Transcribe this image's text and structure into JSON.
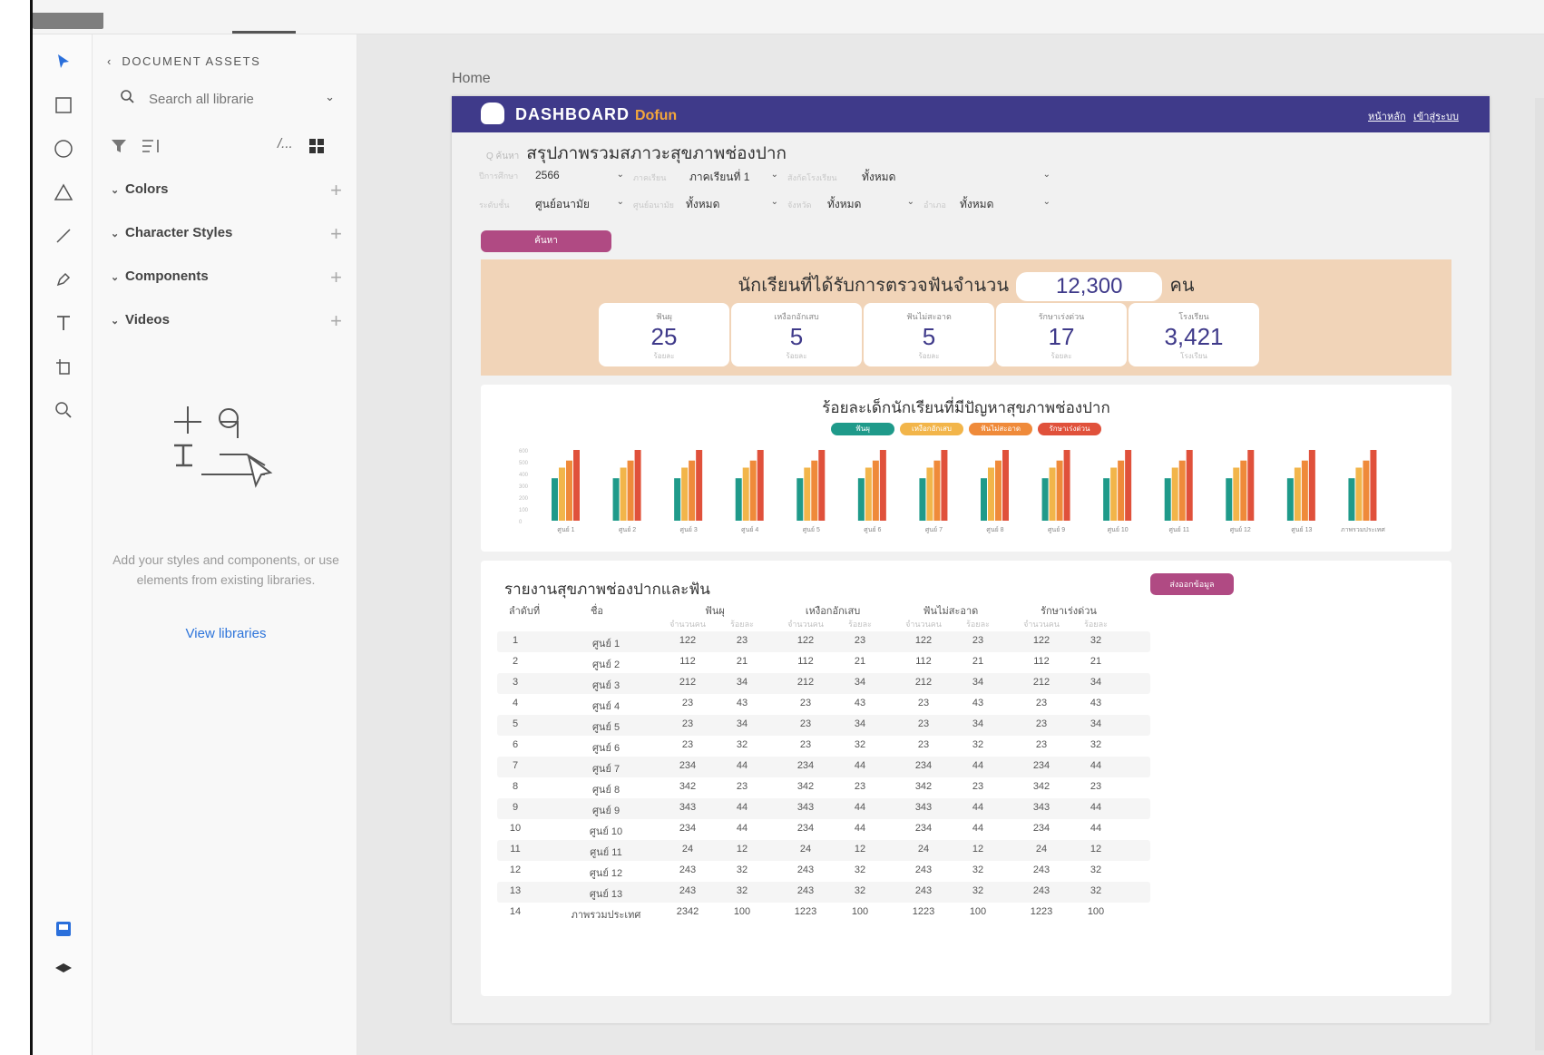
{
  "assets_panel": {
    "header": "DOCUMENT ASSETS",
    "search_placeholder": "Search all librarie",
    "tools_more": "/...",
    "sections": [
      {
        "label": "Colors"
      },
      {
        "label": "Character Styles"
      },
      {
        "label": "Components"
      },
      {
        "label": "Videos"
      }
    ],
    "empty_text": "Add your styles and components, or use elements from existing libraries.",
    "view_libraries": "View libraries"
  },
  "canvas": {
    "breadcrumb": "Home"
  },
  "dashboard": {
    "brand": "DASHBOARD",
    "brand_sub": "Dofun",
    "nav_links": [
      "หน้าหลัก",
      "เข้าสู่ระบบ"
    ],
    "page_title": "สรุปภาพรวมสภาวะสุขภาพช่องปาก",
    "page_title_prefix": "Q ค้นหา",
    "filters": [
      {
        "label": "ปีการศึกษา",
        "value": "2566"
      },
      {
        "label": "ภาคเรียน",
        "value": "ภาคเรียนที่ 1"
      },
      {
        "label": "สังกัดโรงเรียน",
        "value": "ทั้งหมด"
      },
      {
        "label": "ระดับชั้น",
        "value": "ศูนย์อนามัย"
      },
      {
        "label": "ศูนย์อนามัย",
        "value": "ทั้งหมด"
      },
      {
        "label": "จังหวัด",
        "value": "ทั้งหมด"
      },
      {
        "label": "อำเภอ",
        "value": "ทั้งหมด"
      }
    ],
    "search_button": "ค้นหา",
    "summary": {
      "headline": "นักเรียนที่ได้รับการตรวจฟันจำนวน",
      "total": "12,300",
      "unit": "คน",
      "stats": [
        {
          "label": "ฟันผุ",
          "value": "25",
          "unit": "ร้อยละ"
        },
        {
          "label": "เหงือกอักเสบ",
          "value": "5",
          "unit": "ร้อยละ"
        },
        {
          "label": "ฟันไม่สะอาด",
          "value": "5",
          "unit": "ร้อยละ"
        },
        {
          "label": "รักษาเร่งด่วน",
          "value": "17",
          "unit": "ร้อยละ"
        },
        {
          "label": "โรงเรียน",
          "value": "3,421",
          "unit": "โรงเรียน"
        }
      ]
    },
    "chart_title": "ร้อยละเด็กนักเรียนที่มีปัญหาสุขภาพช่องปาก",
    "legend": [
      {
        "label": "ฟันผุ",
        "color": "#1f9a8a"
      },
      {
        "label": "เหงือกอักเสบ",
        "color": "#f2b54a"
      },
      {
        "label": "ฟันไม่สะอาด",
        "color": "#ef8a3a"
      },
      {
        "label": "รักษาเร่งด่วน",
        "color": "#e0513b"
      }
    ],
    "table_title": "รายงานสุขภาพช่องปากและฟัน",
    "export_button": "ส่งออกข้อมูล",
    "table_headers": {
      "no": "ลำดับที่",
      "name": "ชื่อ",
      "groups": [
        "ฟันผุ",
        "เหงือกอักเสบ",
        "ฟันไม่สะอาด",
        "รักษาเร่งด่วน"
      ],
      "sub": [
        "จำนวนคน",
        "ร้อยละ"
      ]
    },
    "table_rows": [
      {
        "no": "1",
        "name": "ศูนย์ 1",
        "v": [
          "122",
          "23",
          "122",
          "23",
          "122",
          "23",
          "122",
          "32"
        ]
      },
      {
        "no": "2",
        "name": "ศูนย์ 2",
        "v": [
          "112",
          "21",
          "112",
          "21",
          "112",
          "21",
          "112",
          "21"
        ]
      },
      {
        "no": "3",
        "name": "ศูนย์ 3",
        "v": [
          "212",
          "34",
          "212",
          "34",
          "212",
          "34",
          "212",
          "34"
        ]
      },
      {
        "no": "4",
        "name": "ศูนย์ 4",
        "v": [
          "23",
          "43",
          "23",
          "43",
          "23",
          "43",
          "23",
          "43"
        ]
      },
      {
        "no": "5",
        "name": "ศูนย์ 5",
        "v": [
          "23",
          "34",
          "23",
          "34",
          "23",
          "34",
          "23",
          "34"
        ]
      },
      {
        "no": "6",
        "name": "ศูนย์ 6",
        "v": [
          "23",
          "32",
          "23",
          "32",
          "23",
          "32",
          "23",
          "32"
        ]
      },
      {
        "no": "7",
        "name": "ศูนย์ 7",
        "v": [
          "234",
          "44",
          "234",
          "44",
          "234",
          "44",
          "234",
          "44"
        ]
      },
      {
        "no": "8",
        "name": "ศูนย์ 8",
        "v": [
          "342",
          "23",
          "342",
          "23",
          "342",
          "23",
          "342",
          "23"
        ]
      },
      {
        "no": "9",
        "name": "ศูนย์ 9",
        "v": [
          "343",
          "44",
          "343",
          "44",
          "343",
          "44",
          "343",
          "44"
        ]
      },
      {
        "no": "10",
        "name": "ศูนย์ 10",
        "v": [
          "234",
          "44",
          "234",
          "44",
          "234",
          "44",
          "234",
          "44"
        ]
      },
      {
        "no": "11",
        "name": "ศูนย์ 11",
        "v": [
          "24",
          "12",
          "24",
          "12",
          "24",
          "12",
          "24",
          "12"
        ]
      },
      {
        "no": "12",
        "name": "ศูนย์ 12",
        "v": [
          "243",
          "32",
          "243",
          "32",
          "243",
          "32",
          "243",
          "32"
        ]
      },
      {
        "no": "13",
        "name": "ศูนย์ 13",
        "v": [
          "243",
          "32",
          "243",
          "32",
          "243",
          "32",
          "243",
          "32"
        ]
      },
      {
        "no": "14",
        "name": "ภาพรวมประเทศ",
        "v": [
          "2342",
          "100",
          "1223",
          "100",
          "1223",
          "100",
          "1223",
          "100"
        ]
      }
    ]
  },
  "chart_data": {
    "type": "bar",
    "categories": [
      "ศูนย์ 1",
      "ศูนย์ 2",
      "ศูนย์ 3",
      "ศูนย์ 4",
      "ศูนย์ 5",
      "ศูนย์ 6",
      "ศูนย์ 7",
      "ศูนย์ 8",
      "ศูนย์ 9",
      "ศูนย์ 10",
      "ศูนย์ 11",
      "ศูนย์ 12",
      "ศูนย์ 13",
      "ภาพรวมประเทศ"
    ],
    "series": [
      {
        "name": "ฟันผุ",
        "color": "#1f9a8a",
        "values": [
          60,
          60,
          60,
          60,
          60,
          60,
          60,
          60,
          60,
          60,
          60,
          60,
          60,
          60
        ]
      },
      {
        "name": "เหงือกอักเสบ",
        "color": "#f2b54a",
        "values": [
          75,
          75,
          75,
          75,
          75,
          75,
          75,
          75,
          75,
          75,
          75,
          75,
          75,
          75
        ]
      },
      {
        "name": "ฟันไม่สะอาด",
        "color": "#ef8a3a",
        "values": [
          85,
          85,
          85,
          85,
          85,
          85,
          85,
          85,
          85,
          85,
          85,
          85,
          85,
          85
        ]
      },
      {
        "name": "รักษาเร่งด่วน",
        "color": "#e0513b",
        "values": [
          100,
          100,
          100,
          100,
          100,
          100,
          100,
          100,
          100,
          100,
          100,
          100,
          100,
          100
        ]
      }
    ],
    "title": "ร้อยละเด็กนักเรียนที่มีปัญหาสุขภาพช่องปาก",
    "yticks": [
      "0",
      "100",
      "200",
      "300",
      "400",
      "500",
      "600"
    ],
    "ylim": [
      0,
      100
    ],
    "legend": "top",
    "grid": false
  }
}
